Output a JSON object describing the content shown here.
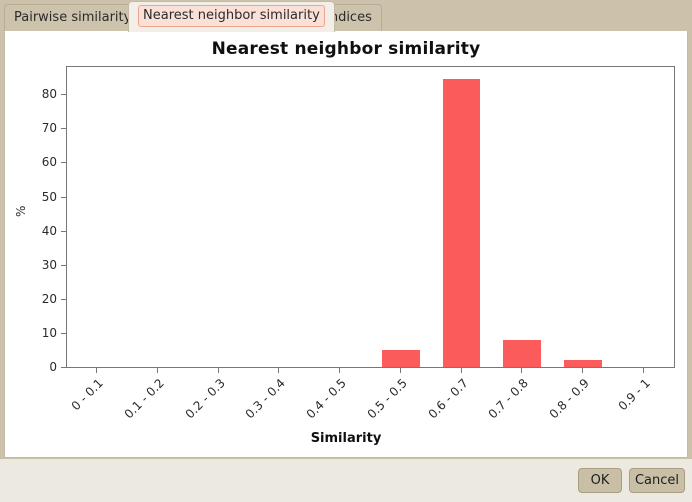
{
  "tabs": [
    {
      "label": "Pairwise similarity",
      "selected": false
    },
    {
      "label": "Nearest neighbor similarity",
      "selected": true
    },
    {
      "label": "Indices",
      "selected": false
    }
  ],
  "footer": {
    "ok_label": "OK",
    "cancel_label": "Cancel"
  },
  "colors": {
    "bar": "#fb5b5b",
    "window_background": "#ccc2ac",
    "panel_background": "#ffffff",
    "footer_background": "#ece9e1",
    "axis": "#777777",
    "tab_selected_highlight": "#fae0d6"
  },
  "chart_data": {
    "type": "bar",
    "title": "Nearest neighbor similarity",
    "xlabel": "Similarity",
    "ylabel": "%",
    "categories": [
      "0 - 0.1",
      "0.1 - 0.2",
      "0.2 - 0.3",
      "0.3 - 0.4",
      "0.4 - 0.5",
      "0.5 - 0.5",
      "0.6 - 0.7",
      "0.7 - 0.8",
      "0.8 - 0.9",
      "0.9 - 1"
    ],
    "values": [
      0,
      0,
      0,
      0,
      0,
      5,
      84.5,
      8,
      2,
      0
    ],
    "ylim": [
      0,
      88
    ],
    "yticks": [
      0,
      10,
      20,
      30,
      40,
      50,
      60,
      70,
      80
    ],
    "ytick_labels": [
      "0",
      "10",
      "20",
      "30",
      "40",
      "50",
      "60",
      "70",
      "80"
    ],
    "grid": false,
    "legend": false
  }
}
